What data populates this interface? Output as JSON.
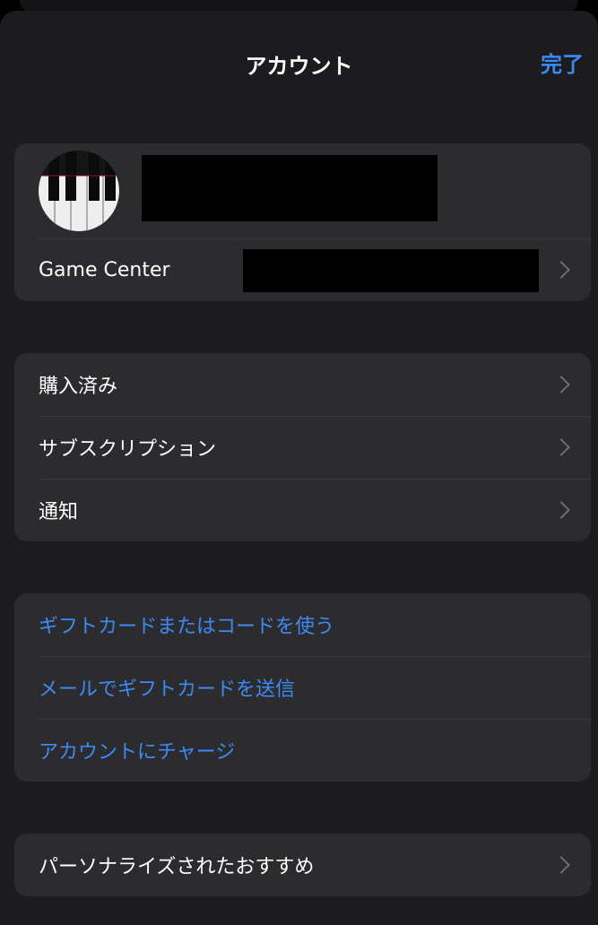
{
  "header": {
    "title": "アカウント",
    "done_label": "完了"
  },
  "profile": {
    "avatar_icon": "piano-keys-avatar",
    "name_redacted": "",
    "game_center_label": "Game Center",
    "game_center_value_redacted": ""
  },
  "menu": {
    "items": [
      {
        "label": "購入済み"
      },
      {
        "label": "サブスクリプション"
      },
      {
        "label": "通知"
      }
    ]
  },
  "links": {
    "items": [
      {
        "label": "ギフトカードまたはコードを使う"
      },
      {
        "label": "メールでギフトカードを送信"
      },
      {
        "label": "アカウントにチャージ"
      }
    ]
  },
  "personalize": {
    "label": "パーソナライズされたおすすめ"
  },
  "colors": {
    "accent": "#3d8af7",
    "sheet_background": "#1c1c1e",
    "cell_background": "#2c2c2e",
    "separator": "#3a3a3c"
  }
}
